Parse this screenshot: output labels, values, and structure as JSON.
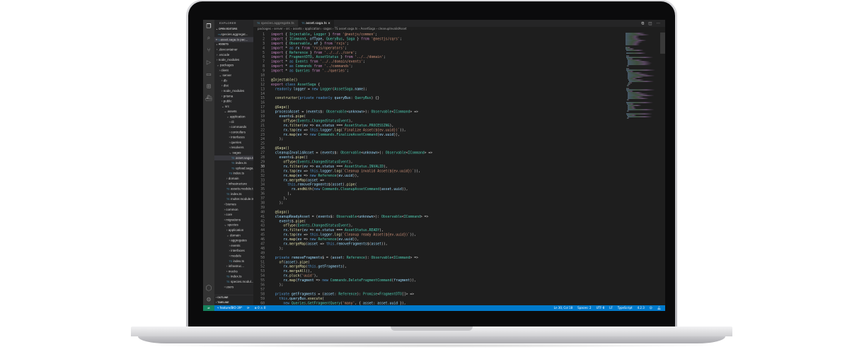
{
  "sidebar": {
    "title": "EXPLORER",
    "open_editors_label": "OPEN EDITORS",
    "open_editors": [
      "species.aggregat...",
      "asset.saga.ts pac..."
    ],
    "workspace_label": "ASSETS",
    "tree": [
      {
        "label": ".devcontainer",
        "depth": 0,
        "type": "folder"
      },
      {
        "label": ".vscode",
        "depth": 0,
        "type": "folder"
      },
      {
        "label": "node_modules",
        "depth": 0,
        "type": "folder"
      },
      {
        "label": "packages",
        "depth": 0,
        "type": "folder-open"
      },
      {
        "label": "client",
        "depth": 1,
        "type": "folder"
      },
      {
        "label": "server",
        "depth": 1,
        "type": "folder-open"
      },
      {
        "label": "db",
        "depth": 2,
        "type": "folder"
      },
      {
        "label": "dist",
        "depth": 2,
        "type": "folder"
      },
      {
        "label": "node_modules",
        "depth": 2,
        "type": "folder"
      },
      {
        "label": "prisma",
        "depth": 2,
        "type": "folder"
      },
      {
        "label": "public",
        "depth": 2,
        "type": "folder"
      },
      {
        "label": "src",
        "depth": 2,
        "type": "folder-open"
      },
      {
        "label": "assets",
        "depth": 3,
        "type": "folder-open"
      },
      {
        "label": "application",
        "depth": 4,
        "type": "folder-open"
      },
      {
        "label": "cli",
        "depth": 5,
        "type": "folder"
      },
      {
        "label": "commands",
        "depth": 5,
        "type": "folder"
      },
      {
        "label": "controllers",
        "depth": 5,
        "type": "folder"
      },
      {
        "label": "interfaces",
        "depth": 5,
        "type": "folder"
      },
      {
        "label": "queries",
        "depth": 5,
        "type": "folder"
      },
      {
        "label": "resolvers",
        "depth": 5,
        "type": "folder"
      },
      {
        "label": "sagas",
        "depth": 5,
        "type": "folder-open"
      },
      {
        "label": "asset.saga.ts",
        "depth": 6,
        "type": "file",
        "selected": true
      },
      {
        "label": "index.ts",
        "depth": 6,
        "type": "file"
      },
      {
        "label": "upload.saga...",
        "depth": 6,
        "type": "file"
      },
      {
        "label": "index.ts",
        "depth": 5,
        "type": "file"
      },
      {
        "label": "domain",
        "depth": 4,
        "type": "folder"
      },
      {
        "label": "infrastructure",
        "depth": 4,
        "type": "folder"
      },
      {
        "label": "assets.module.ts",
        "depth": 4,
        "type": "file"
      },
      {
        "label": "index.ts",
        "depth": 4,
        "type": "file"
      },
      {
        "label": "multer.module.ts",
        "depth": 4,
        "type": "file"
      },
      {
        "label": "biomes",
        "depth": 3,
        "type": "folder"
      },
      {
        "label": "common",
        "depth": 3,
        "type": "folder"
      },
      {
        "label": "core",
        "depth": 3,
        "type": "folder"
      },
      {
        "label": "migrations",
        "depth": 3,
        "type": "folder"
      },
      {
        "label": "species",
        "depth": 3,
        "type": "folder-open"
      },
      {
        "label": "application",
        "depth": 4,
        "type": "folder"
      },
      {
        "label": "domain",
        "depth": 4,
        "type": "folder-open"
      },
      {
        "label": "aggregates",
        "depth": 5,
        "type": "folder"
      },
      {
        "label": "events",
        "depth": 5,
        "type": "folder"
      },
      {
        "label": "interfaces",
        "depth": 5,
        "type": "folder"
      },
      {
        "label": "models",
        "depth": 5,
        "type": "folder"
      },
      {
        "label": "index.ts",
        "depth": 5,
        "type": "file"
      },
      {
        "label": "infrastruc...",
        "depth": 4,
        "type": "folder"
      },
      {
        "label": "mocks",
        "depth": 4,
        "type": "folder"
      },
      {
        "label": "index.ts",
        "depth": 4,
        "type": "file"
      },
      {
        "label": "species.modul...",
        "depth": 4,
        "type": "file"
      },
      {
        "label": "users",
        "depth": 3,
        "type": "folder"
      }
    ],
    "outline_label": "OUTLINE",
    "timeline_label": "TIMELINE"
  },
  "tabs": [
    {
      "label": "species.aggregate.ts",
      "active": false
    },
    {
      "label": "asset.saga.ts",
      "active": true
    }
  ],
  "breadcrumb": "packages › server › src › assets › application › sagas › TS asset.saga.ts › AssetSaga › cleanupInvalidAsset",
  "current_line": 30,
  "code": [
    "import { Injectable, Logger } from '@nestjs/common';",
    "import { ICommand, ofType, QueryBus, Saga } from '@nestjs/cqrs';",
    "import { Observable, of } from 'rxjs';",
    "import * as rx from 'rxjs/operators';",
    "import { Reference } from '../../../core';",
    "import { FragmentDTO, AssetStatus } from '../../domain';",
    "import * as Events from '../../domain/events';",
    "import * as Commands from '../commands';",
    "import * as Queries from '../queries';",
    "",
    "@Injectable()",
    "export class AssetSaga {",
    "  readonly logger = new Logger(AssetSaga.name);",
    "",
    "  constructor(private readonly queryBus: QueryBus) {}",
    "",
    "  @Saga()",
    "  processAsset = (events$: Observable<unknown>): Observable<ICommand> =>",
    "    events$.pipe(",
    "      ofType(Events.ChangedStatusEvent),",
    "      rx.filter(ev => ev.status === AssetStatus.PROCESSING),",
    "      rx.tap(ev => this.logger.log(`Finalize Asset(${ev.uuid})`)),",
    "      rx.map(ev => new Commands.FinalizeAssetCommand(ev.uuid)),",
    "    );",
    "",
    "  @Saga()",
    "  cleanupInvalidAsset = (events$: Observable<unknown>): Observable<ICommand> =>",
    "    events$.pipe()",
    "      ofType(Events.ChangedStatusEvent),",
    "      rx.filter(ev => ev.status === AssetStatus.INVALID),",
    "      rx.tap(ev => this.logger.log(`Cleanup invalid Asset(${ev.uuid})`)),",
    "      rx.map(ev => new Reference(ev.uuid)),",
    "      rx.mergeMap(asset =>",
    "        this.removeFragments$(asset).pipe(",
    "          rx.endWith(new Commands.CleanupAssetCommand(asset.uuid)),",
    "        ),",
    "      ),",
    "    );",
    "",
    "  @Saga()",
    "  cleanupReadyAsset = (events$: Observable<unknown>): Observable<ICommand> =>",
    "    events$.pipe(",
    "      ofType(Events.ChangedStatusEvent),",
    "      rx.filter(ev => ev.status === AssetStatus.READY),",
    "      rx.tap(ev => this.logger.log(`Cleanup ready Asset(${ev.uuid})`)),",
    "      rx.map(ev => new Reference(ev.uuid)),",
    "      rx.mergeMap(asset => this.removeFragments$(asset)),",
    "    );",
    "",
    "  private removeFragments$ = (asset: Reference): Observable<ICommand> =>",
    "    of(asset).pipe(",
    "      rx.mergeMap(this.getFragments),",
    "      rx.mergeAll(),",
    "      rx.pluck('uuid'),",
    "      rx.map(fragment => new Commands.DeleteFragmentCommand(fragment)),",
    "    );",
    "",
    "  private getFragments = (asset: Reference): Promise<FragmentDTO[]> =>",
    "    this.queryBus.execute(",
    "      new Queries.GetFragmentQuery('many', { asset: asset.uuid }),",
    "    );"
  ],
  "status": {
    "branch": "feature/BIO-39*",
    "errors": "0",
    "warnings": "0",
    "position": "Ln 30, Col 18",
    "indent": "Spaces: 2",
    "encoding": "UTF-8",
    "eol": "LF",
    "language": "TypeScript",
    "ts_version": "4.2.3"
  }
}
